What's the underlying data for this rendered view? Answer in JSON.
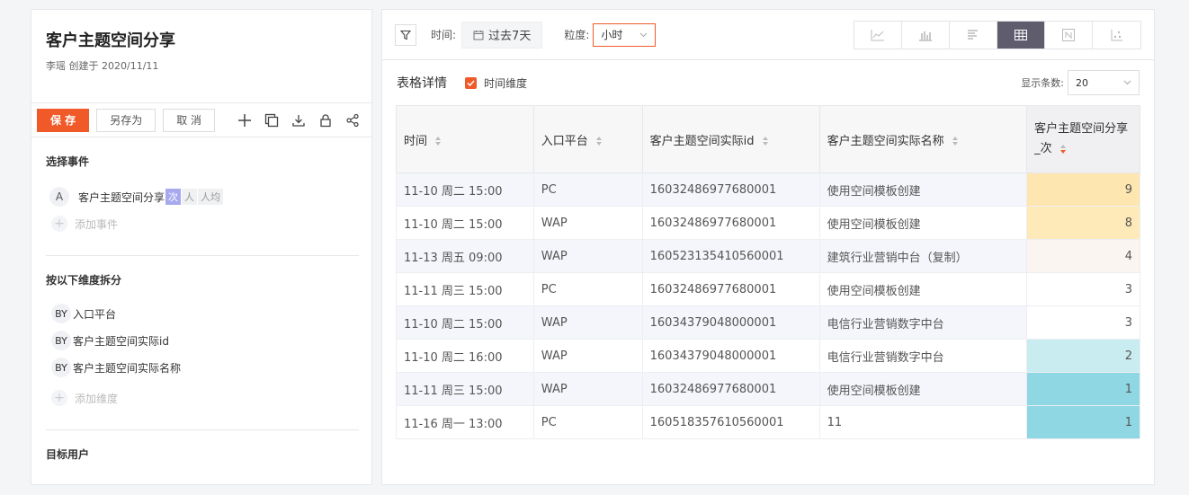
{
  "report": {
    "title": "客户主题空间分享",
    "subtitle": "李瑶 创建于 2020/11/11"
  },
  "toolbar": {
    "save_label": "保 存",
    "save_as_label": "另存为",
    "cancel_label": "取 消"
  },
  "events": {
    "section_title": "选择事件",
    "item": {
      "letter": "A",
      "name": "客户主题空间分享",
      "chips": [
        "次",
        "人",
        "人均"
      ],
      "active_chip": "次"
    },
    "add_label": "添加事件"
  },
  "dimensions": {
    "section_title": "按以下维度拆分",
    "items": [
      {
        "prefix": "BY",
        "label": "入口平台"
      },
      {
        "prefix": "BY",
        "label": "客户主题空间实际id"
      },
      {
        "prefix": "BY",
        "label": "客户主题空间实际名称"
      }
    ],
    "add_label": "添加维度"
  },
  "target": {
    "section_title": "目标用户"
  },
  "filters": {
    "time_label": "时间:",
    "time_value": "过去7天",
    "granularity_label": "粒度:",
    "granularity_value": "小时"
  },
  "table_section": {
    "title": "表格详情",
    "time_dimension_label": "时间维度",
    "show_count_label": "显示条数:",
    "show_count_value": "20"
  },
  "table": {
    "headers": [
      "时间",
      "入口平台",
      "客户主题空间实际id",
      "客户主题空间实际名称",
      "客户主题空间分享_次"
    ],
    "rows": [
      [
        "11-10 周二 15:00",
        "PC",
        "16032486977680001",
        "使用空间模板创建",
        "9"
      ],
      [
        "11-10 周二 15:00",
        "WAP",
        "16032486977680001",
        "使用空间模板创建",
        "8"
      ],
      [
        "11-13 周五 09:00",
        "WAP",
        "160523135410560001",
        "建筑行业营销中台（复制）",
        "4"
      ],
      [
        "11-11 周三 15:00",
        "PC",
        "16032486977680001",
        "使用空间模板创建",
        "3"
      ],
      [
        "11-10 周二 15:00",
        "WAP",
        "16034379048000001",
        "电信行业营销数字中台",
        "3"
      ],
      [
        "11-10 周二 16:00",
        "WAP",
        "16034379048000001",
        "电信行业营销数字中台",
        "2"
      ],
      [
        "11-11 周三 15:00",
        "WAP",
        "16032486977680001",
        "使用空间模板创建",
        "1"
      ],
      [
        "11-16 周一 13:00",
        "PC",
        "160518357610560001",
        "11",
        "1"
      ]
    ],
    "heat_colors": [
      "#fde6b0",
      "#fdeab8",
      "#faf5f0",
      "#ffffff",
      "#ffffff",
      "#c8ecef",
      "#8fd7e3",
      "#8fd7e3"
    ]
  },
  "colors": {
    "accent": "#f05a28",
    "chip_active": "#a6a9ee",
    "chart_type_active": "#5f5c6e"
  }
}
